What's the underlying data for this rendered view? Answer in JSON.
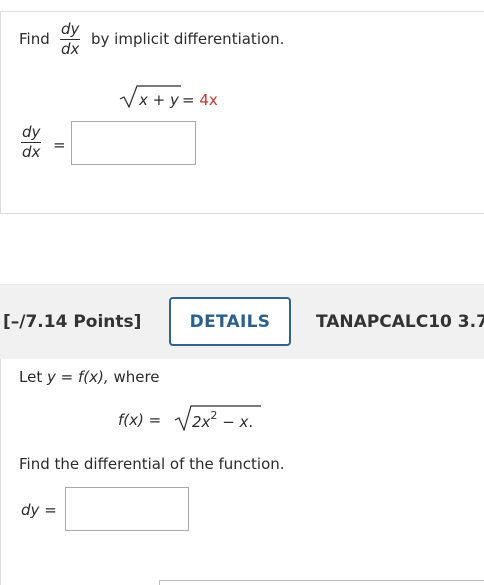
{
  "q1": {
    "find": "Find",
    "dy": "dy",
    "dx": "dx",
    "by_text": "by implicit differentiation.",
    "eq_radicand": "x + y",
    "eq_equals": "=",
    "eq_rhs": "4x",
    "answer_lhs_num": "dy",
    "answer_lhs_den": "dx",
    "answer_equals": "=",
    "answer_value": ""
  },
  "q2": {
    "points": "[–/7.14 Points]",
    "details_label": "DETAILS",
    "source": "TANAPCALC10 3.7",
    "let_prefix": "Let",
    "let_y": "y",
    "let_eq": "=",
    "let_fx": "f(x),",
    "let_where": "where",
    "func_lhs": "f(x) =",
    "func_term1": "2x",
    "func_exp": "2",
    "func_term2": " − x",
    "func_end": ".",
    "find_text": "Find the differential of the function.",
    "dy_label": "dy",
    "dy_equals": "=",
    "answer_value": ""
  },
  "colors": {
    "accent": "#31638e",
    "equation_red": "#c0392b",
    "header_bg": "#f1f1f1"
  }
}
